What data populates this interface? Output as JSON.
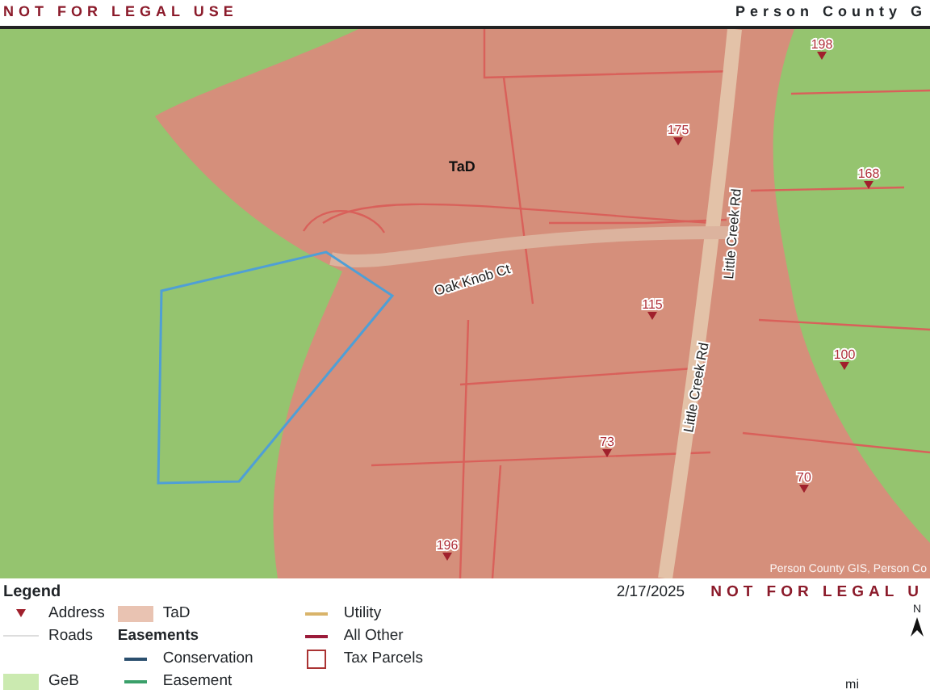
{
  "header": {
    "notice": "NOT FOR LEGAL USE",
    "county": "Person County G"
  },
  "map": {
    "soil_label": "TaD",
    "attribution": "Person County GIS, Person Co",
    "roads": [
      {
        "kind": "court",
        "label": "Oak Knob Ct"
      },
      {
        "kind": "road_north",
        "label": "Little Creek Rd"
      },
      {
        "kind": "road_south",
        "label": "Little Creek Rd"
      }
    ],
    "addresses": [
      {
        "label": "198"
      },
      {
        "label": "175"
      },
      {
        "label": "168"
      },
      {
        "label": "115"
      },
      {
        "label": "100"
      },
      {
        "label": "73"
      },
      {
        "label": "70"
      },
      {
        "label": "196"
      }
    ]
  },
  "legend": {
    "title": "Legend",
    "date": "2/17/2025",
    "notice": "NOT FOR LEGAL U",
    "north": "N",
    "scale_unit": "mi",
    "columns": [
      [
        {
          "kind": "address",
          "label": "Address"
        },
        {
          "kind": "road",
          "label": "Roads"
        },
        {
          "kind": "blank"
        },
        {
          "kind": "soil_geb",
          "label": "GeB"
        }
      ],
      [
        {
          "kind": "soil_tad",
          "label": "TaD"
        },
        {
          "kind": "heading",
          "label": "Easements"
        },
        {
          "kind": "conservation",
          "label": "Conservation"
        },
        {
          "kind": "easement",
          "label": "Easement"
        }
      ],
      [
        {
          "kind": "utility",
          "label": "Utility"
        },
        {
          "kind": "all_other",
          "label": "All Other"
        },
        {
          "kind": "tax_parcel",
          "label": "Tax Parcels"
        }
      ]
    ]
  }
}
